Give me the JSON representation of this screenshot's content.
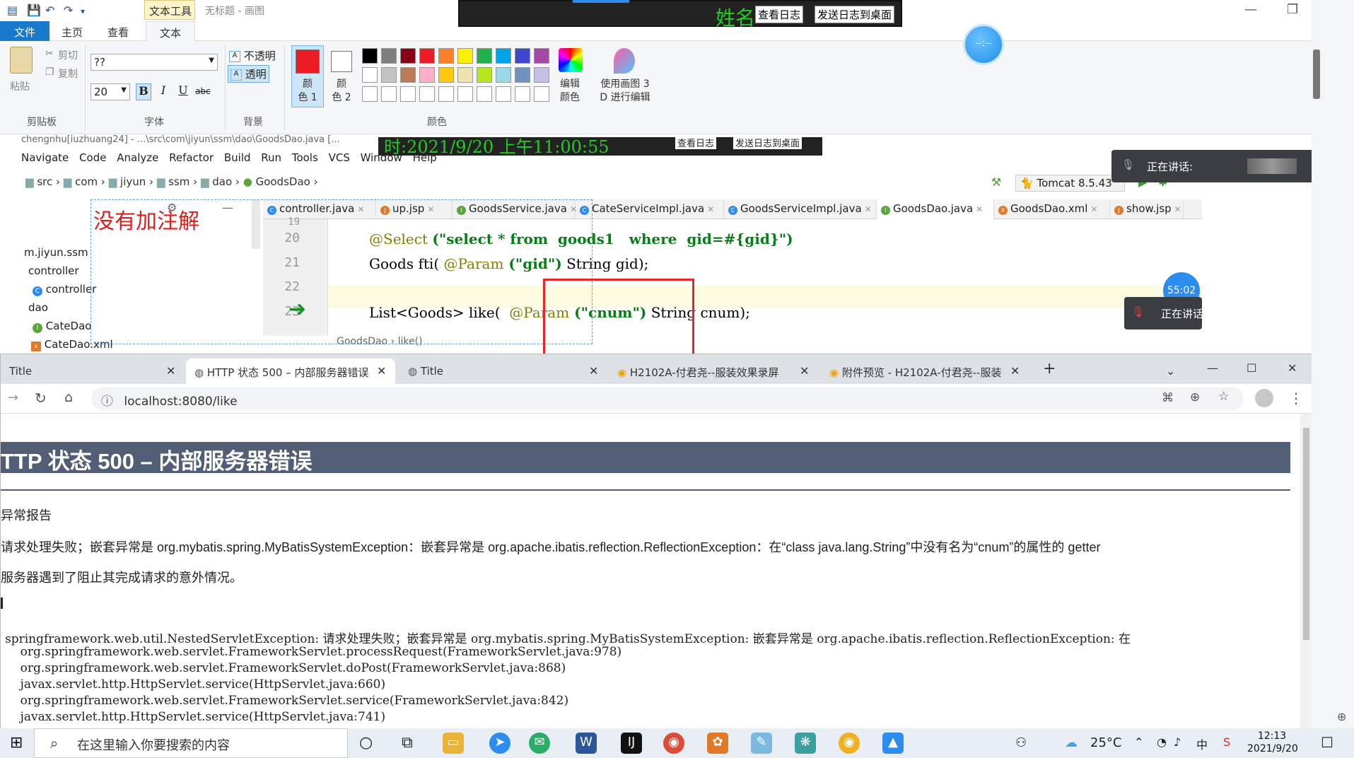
{
  "paint": {
    "context_tab": "文本工具",
    "doc_title": "无标题 - 画图",
    "tabs": [
      "文件",
      "主页",
      "查看",
      "文本"
    ],
    "clipboard": {
      "paste": "粘贴",
      "cut": "剪切",
      "copy": "复制",
      "group": "剪贴板"
    },
    "font": {
      "family": "??",
      "size": "20",
      "bold": "B",
      "italic": "I",
      "underline": "U",
      "strike": "abc",
      "group": "字体"
    },
    "background": {
      "opaque": "不透明",
      "transparent": "透明",
      "group": "背景"
    },
    "colors": {
      "color1_label": "颜\n色 1",
      "color2_label": "颜\n色 2",
      "edit_label": "编辑\n颜色",
      "paint3d_label": "使用画图 3\nD 进行编辑",
      "group": "颜色",
      "color1": "#ed1c24",
      "color2": "#ffffff",
      "palette_row1": [
        "#000000",
        "#7f7f7f",
        "#880015",
        "#ed1c24",
        "#ff7f27",
        "#fff200",
        "#22b14c",
        "#00a2e8",
        "#3f48cc",
        "#a349a4"
      ],
      "palette_row2": [
        "#ffffff",
        "#c3c3c3",
        "#b97a57",
        "#ffaec9",
        "#ffc90e",
        "#efe4b0",
        "#b5e61d",
        "#99d9ea",
        "#7092be",
        "#c8bfe7"
      ],
      "palette_row3": [
        "#ffffff",
        "#ffffff",
        "#ffffff",
        "#ffffff",
        "#ffffff",
        "#ffffff",
        "#ffffff",
        "#ffffff",
        "#ffffff",
        "#ffffff"
      ]
    }
  },
  "recorder": {
    "name": "姓名",
    "view_log": "查看日志",
    "send_log": "发送日志到桌面",
    "circle_text": "--:--",
    "ide_strip": "时:2021/9/20 上午11:00:55",
    "ide_strip_btn1": "查看日志",
    "ide_strip_btn2": "发送日志到桌面"
  },
  "ide": {
    "path_strip": "chengnhu[iuzhuang24] - ...\\src\\com\\jiyun\\ssm\\dao\\GoodsDao.java [...",
    "menu": [
      "Navigate",
      "Code",
      "Analyze",
      "Refactor",
      "Build",
      "Run",
      "Tools",
      "VCS",
      "Window",
      "Help"
    ],
    "breadcrumb": [
      "src",
      "com",
      "jiyun",
      "ssm",
      "dao",
      "GoodsDao"
    ],
    "run_config": "Tomcat 8.5.43",
    "tree": [
      "m.jiyun.ssm",
      "controller",
      "controller",
      "dao",
      "CateDao",
      "CateDao.xml"
    ],
    "tabs": [
      "controller.java",
      "up.jsp",
      "GoodsService.java",
      "CateServiceImpl.java",
      "GoodsServiceImpl.java",
      "GoodsDao.java",
      "GoodsDao.xml",
      "show.jsp"
    ],
    "active_tab": "GoodsDao.java",
    "line_numbers": [
      "19",
      "20",
      "21",
      "22",
      "23"
    ],
    "line20_anno": "@Select",
    "line20_str": "(\"select * from  goods1   where  gid=#{gid}\")",
    "line21_pre": "Goods fti( ",
    "line21_anno": "@Param",
    "line21_str": " (\"gid\")",
    "line21_post": " String gid);",
    "line23_pre": "List<Goods> like(  ",
    "line23_anno": "@Param",
    "line23_str": " (\"cnum\")",
    "line23_post": " String cnum);",
    "bottom_crumb": "GoodsDao  ›  like()",
    "annotation_note": "没有加注解"
  },
  "meeting": {
    "speaking": "正在讲话:",
    "speaking2": "正在讲话",
    "timer": "55:02"
  },
  "browser": {
    "tabs": [
      "Title",
      "HTTP 状态 500 – 内部服务器错误",
      "Title",
      "H2102A-付君尧--服装效果录屏",
      "附件预览 - H2102A-付君尧--服装"
    ],
    "active_tab": 1,
    "url": "localhost:8080/like",
    "heading": "TTP 状态 500 – 内部服务器错误",
    "type_line": "异常报告",
    "message_line": "请求处理失败；嵌套异常是 org.mybatis.spring.MyBatisSystemException：嵌套异常是 org.apache.ibatis.reflection.ReflectionException：在“class java.lang.String”中没有名为“cnum”的属性的 getter",
    "desc_line": "服务器遇到了阻止其完成请求的意外情况。",
    "trace": [
      "springframework.web.util.NestedServletException: 请求处理失败；嵌套异常是 org.mybatis.spring.MyBatisSystemException: 嵌套异常是 org.apache.ibatis.reflection.ReflectionException: 在",
      "    org.springframework.web.servlet.FrameworkServlet.processRequest(FrameworkServlet.java:978)",
      "    org.springframework.web.servlet.FrameworkServlet.doPost(FrameworkServlet.java:868)",
      "    javax.servlet.http.HttpServlet.service(HttpServlet.java:660)",
      "    org.springframework.web.servlet.FrameworkServlet.service(FrameworkServlet.java:842)",
      "    javax.servlet.http.HttpServlet.service(HttpServlet.java:741)"
    ]
  },
  "taskbar": {
    "search_placeholder": "在这里输入你要搜索的内容",
    "weather": "25°C",
    "ime": "中",
    "time": "12:13",
    "date": "2021/9/20"
  }
}
